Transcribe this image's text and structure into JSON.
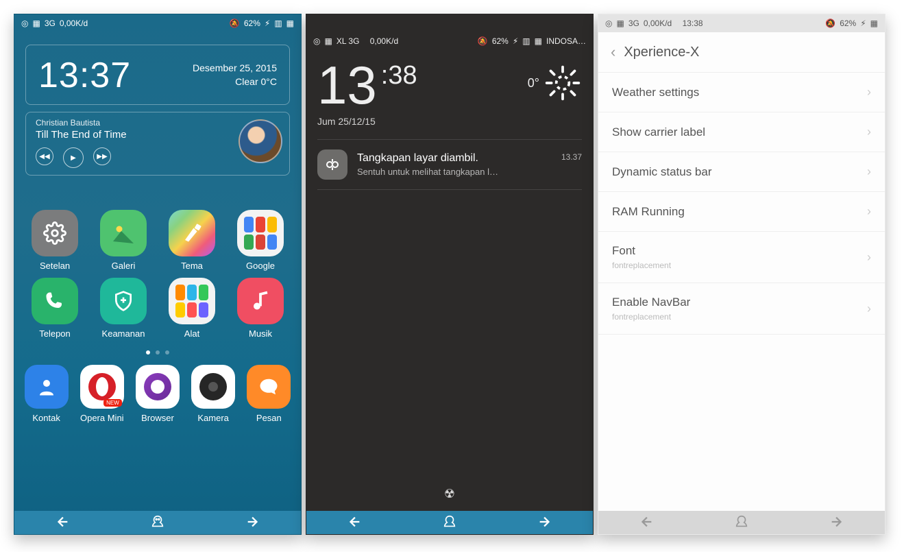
{
  "screen1": {
    "status": {
      "net": "3G",
      "speed": "0,00K/d",
      "battery": "62%"
    },
    "clock": {
      "time": "13:37",
      "date": "Desember  25, 2015",
      "weather": "Clear  0°C"
    },
    "music": {
      "artist": "Christian Bautista",
      "song": "Till The End of Time"
    },
    "apps": [
      {
        "label": "Setelan"
      },
      {
        "label": "Galeri"
      },
      {
        "label": "Tema"
      },
      {
        "label": "Google"
      },
      {
        "label": "Telepon"
      },
      {
        "label": "Keamanan"
      },
      {
        "label": "Alat"
      },
      {
        "label": "Musik"
      }
    ],
    "dock": [
      {
        "label": "Kontak"
      },
      {
        "label": "Opera Mini"
      },
      {
        "label": "Browser"
      },
      {
        "label": "Kamera"
      },
      {
        "label": "Pesan"
      }
    ]
  },
  "screen2": {
    "status": {
      "carrier_left": "XL 3G",
      "speed": "0,00K/d",
      "battery": "62%",
      "carrier_right": "INDOSA…"
    },
    "time": {
      "hh": "13",
      "mm": ":38"
    },
    "temp": "0°",
    "date": "Jum 25/12/15",
    "notif": {
      "title": "Tangkapan layar diambil.",
      "sub": "Sentuh untuk melihat tangkapan l…",
      "time": "13.37"
    }
  },
  "screen3": {
    "status": {
      "net": "3G",
      "speed": "0,00K/d",
      "clock": "13:38",
      "battery": "62%"
    },
    "title": "Xperience-X",
    "items": [
      {
        "label": "Weather settings"
      },
      {
        "label": "Show carrier label"
      },
      {
        "label": "Dynamic status bar"
      },
      {
        "label": "RAM Running"
      },
      {
        "label": "Font",
        "sub": "fontreplacement"
      },
      {
        "label": "Enable NavBar",
        "sub": "fontreplacement"
      }
    ]
  }
}
